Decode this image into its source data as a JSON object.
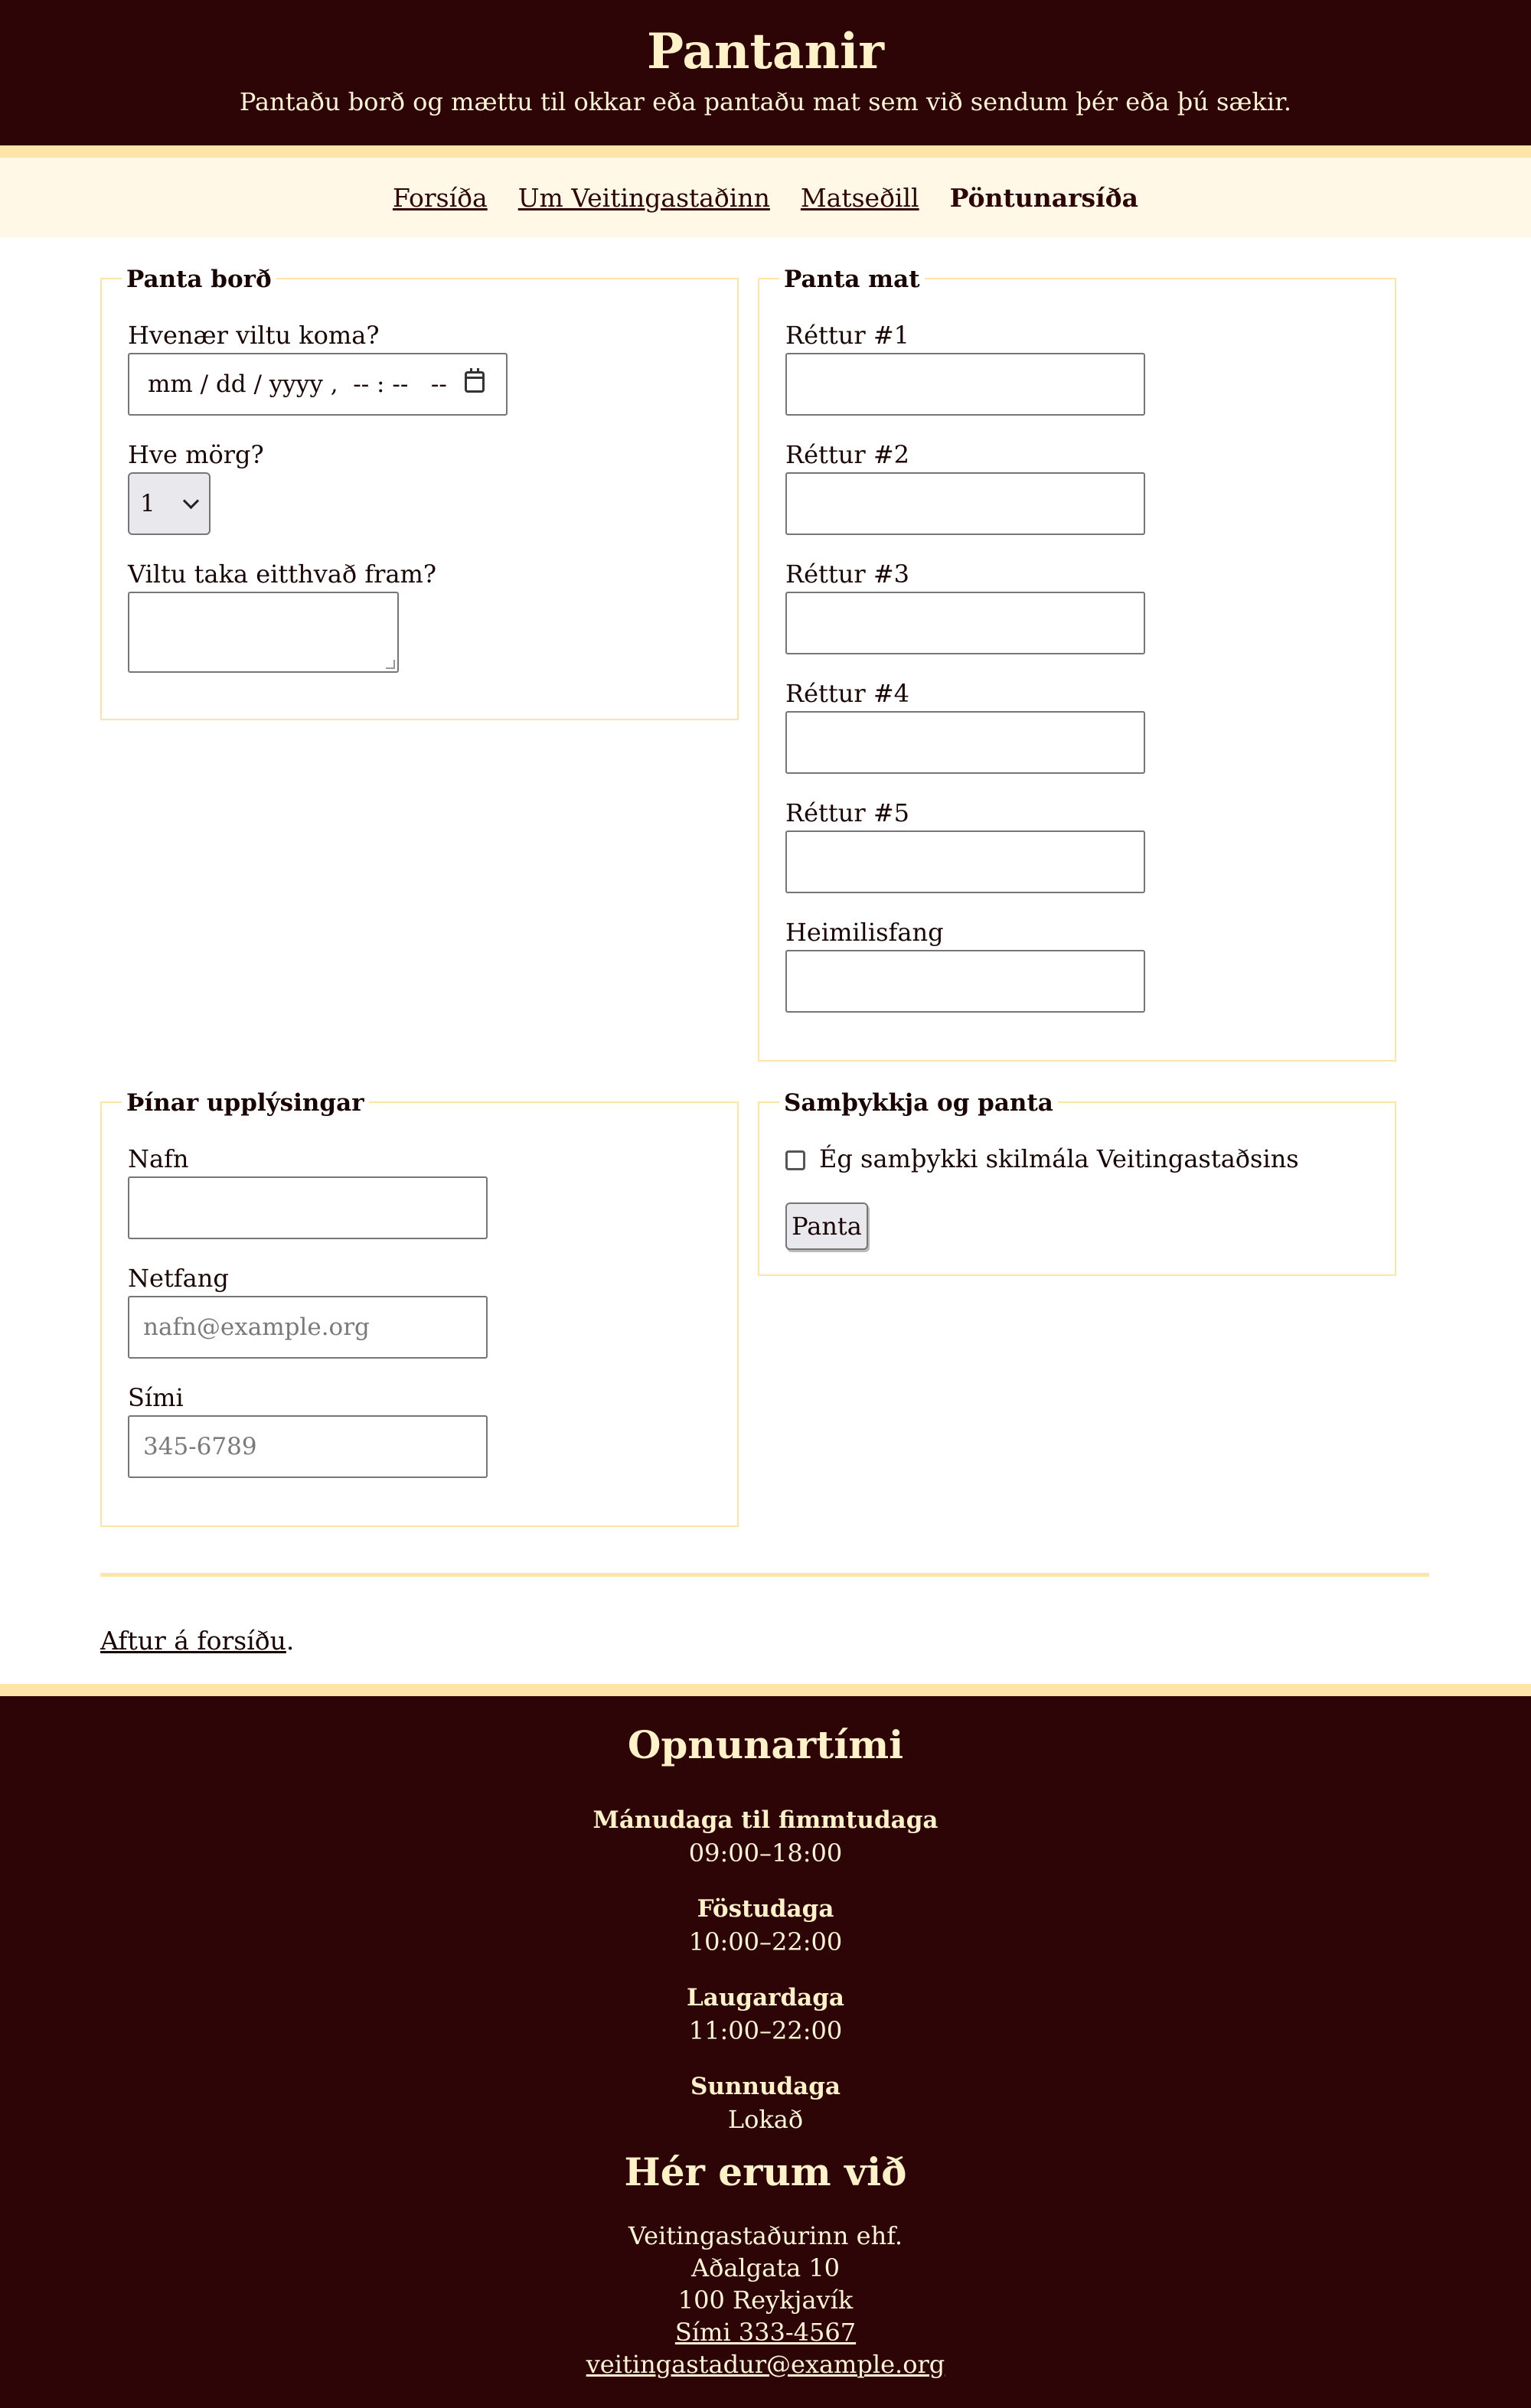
{
  "header": {
    "title": "Pantanir",
    "subtitle": "Pantaðu borð og mættu til okkar eða pantaðu mat sem við sendum þér eða þú sækir."
  },
  "nav": {
    "items": [
      {
        "label": "Forsíða"
      },
      {
        "label": "Um Veitingastaðinn"
      },
      {
        "label": "Matseðill"
      },
      {
        "label": "Pöntunarsíða",
        "current": true
      }
    ]
  },
  "table_booking": {
    "legend": "Panta borð",
    "when_label": "Hvenær viltu koma?",
    "when_placeholder": "mm / dd / yyyy ,  -- : --   --",
    "count_label": "Hve mörg?",
    "count_value": "1",
    "notes_label": "Viltu taka eitthvað fram?",
    "notes_value": ""
  },
  "food_order": {
    "legend": "Panta mat",
    "dishes": [
      {
        "label": "Réttur #1",
        "value": ""
      },
      {
        "label": "Réttur #2",
        "value": ""
      },
      {
        "label": "Réttur #3",
        "value": ""
      },
      {
        "label": "Réttur #4",
        "value": ""
      },
      {
        "label": "Réttur #5",
        "value": ""
      }
    ],
    "address_label": "Heimilisfang",
    "address_value": ""
  },
  "your_info": {
    "legend": "Þínar upplýsingar",
    "name_label": "Nafn",
    "name_value": "",
    "email_label": "Netfang",
    "email_placeholder": "nafn@example.org",
    "phone_label": "Sími",
    "phone_placeholder": "345-6789"
  },
  "confirm": {
    "legend": "Samþykkja og panta",
    "terms_label": "Ég samþykki skilmála Veitingastaðsins",
    "terms_checked": false,
    "submit_label": "Panta"
  },
  "back": {
    "link_label": "Aftur á forsíðu",
    "suffix": "."
  },
  "footer": {
    "hours_title": "Opnunartími",
    "hours": [
      {
        "day": "Mánudaga til fimmtudaga",
        "time": "09:00–18:00"
      },
      {
        "day": "Föstudaga",
        "time": "10:00–22:00"
      },
      {
        "day": "Laugardaga",
        "time": "11:00–22:00"
      },
      {
        "day": "Sunnudaga",
        "time": "Lokað"
      }
    ],
    "location_title": "Hér erum við",
    "company": "Veitingastaðurinn ehf.",
    "street": "Aðalgata 10",
    "city": "100 Reykjavík",
    "phone": "Sími 333-4567",
    "email": "veitingastadur@example.org"
  },
  "colors": {
    "dark": "#2e0506",
    "accent": "#fde5a8",
    "nav_bg": "#fff8e6"
  }
}
